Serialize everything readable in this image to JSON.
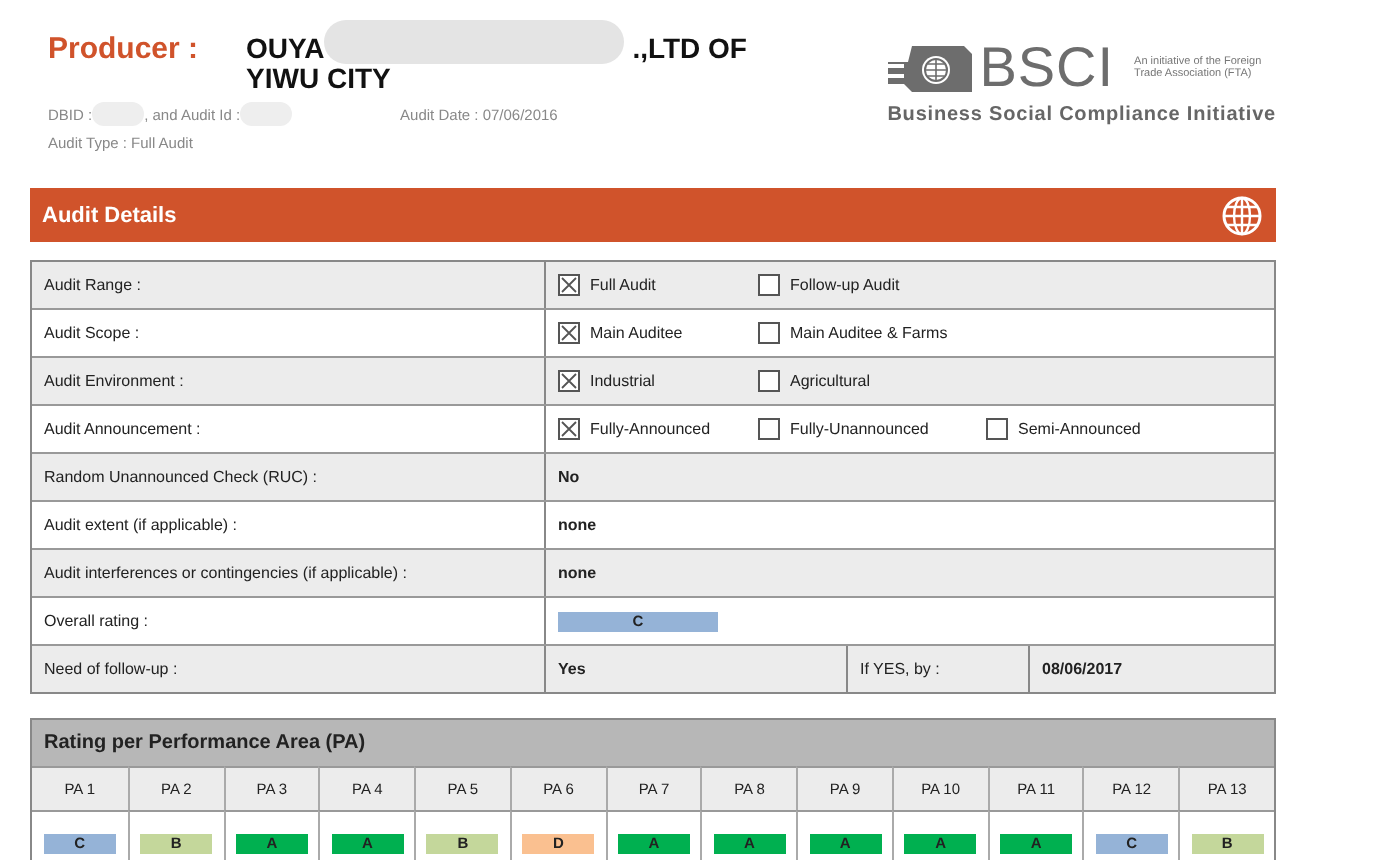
{
  "producer": {
    "label": "Producer :",
    "name_start": "OUYA",
    "name_end": ".,LTD OF",
    "name_line2": "YIWU CITY"
  },
  "meta": {
    "dbid": "DBID :",
    "audit_id": ", and Audit Id :",
    "audit_date": "Audit Date : 07/06/2016",
    "audit_type": "Audit Type : Full Audit"
  },
  "logo": {
    "mark": "BSCI",
    "tagline_1": "An initiative of the Foreign",
    "tagline_2": "Trade Association (FTA)",
    "full_name": "Business Social Compliance Initiative"
  },
  "section": {
    "title": "Audit Details"
  },
  "rows": [
    {
      "kind": "options",
      "label": "Audit Range :",
      "options": [
        {
          "label": "Full Audit",
          "checked": true
        },
        {
          "label": "Follow-up Audit",
          "checked": false
        }
      ]
    },
    {
      "kind": "options",
      "label": "Audit Scope :",
      "options": [
        {
          "label": "Main Auditee",
          "checked": true
        },
        {
          "label": "Main Auditee & Farms",
          "checked": false
        }
      ]
    },
    {
      "kind": "options",
      "label": "Audit Environment :",
      "options": [
        {
          "label": "Industrial",
          "checked": true
        },
        {
          "label": "Agricultural",
          "checked": false
        }
      ]
    },
    {
      "kind": "options",
      "label": "Audit Announcement :",
      "options": [
        {
          "label": "Fully-Announced",
          "checked": true
        },
        {
          "label": "Fully-Unannounced",
          "checked": false
        },
        {
          "label": "Semi-Announced",
          "checked": false
        }
      ]
    },
    {
      "kind": "text",
      "label": "Random Unannounced Check (RUC) :",
      "value": "No"
    },
    {
      "kind": "text",
      "label": "Audit extent (if applicable) :",
      "value": "none"
    },
    {
      "kind": "text",
      "label": "Audit interferences or contingencies (if applicable) :",
      "value": "none"
    },
    {
      "kind": "rating",
      "label": "Overall rating :",
      "value": "C",
      "color": "#95b3d7"
    },
    {
      "kind": "followup",
      "label": "Need of follow-up :",
      "value": "Yes",
      "by_label": "If YES, by :",
      "by_value": "08/06/2017"
    }
  ],
  "pa": {
    "title": "Rating per Performance Area (PA)",
    "areas": [
      {
        "name": "PA 1",
        "rating": "C",
        "color": "#95b3d7"
      },
      {
        "name": "PA 2",
        "rating": "B",
        "color": "#c4d79b"
      },
      {
        "name": "PA 3",
        "rating": "A",
        "color": "#00b050"
      },
      {
        "name": "PA 4",
        "rating": "A",
        "color": "#00b050"
      },
      {
        "name": "PA 5",
        "rating": "B",
        "color": "#c4d79b"
      },
      {
        "name": "PA 6",
        "rating": "D",
        "color": "#fac090"
      },
      {
        "name": "PA 7",
        "rating": "A",
        "color": "#00b050"
      },
      {
        "name": "PA 8",
        "rating": "A",
        "color": "#00b050"
      },
      {
        "name": "PA 9",
        "rating": "A",
        "color": "#00b050"
      },
      {
        "name": "PA 10",
        "rating": "A",
        "color": "#00b050"
      },
      {
        "name": "PA 11",
        "rating": "A",
        "color": "#00b050"
      },
      {
        "name": "PA 12",
        "rating": "C",
        "color": "#95b3d7"
      },
      {
        "name": "PA 13",
        "rating": "B",
        "color": "#c4d79b"
      }
    ]
  }
}
